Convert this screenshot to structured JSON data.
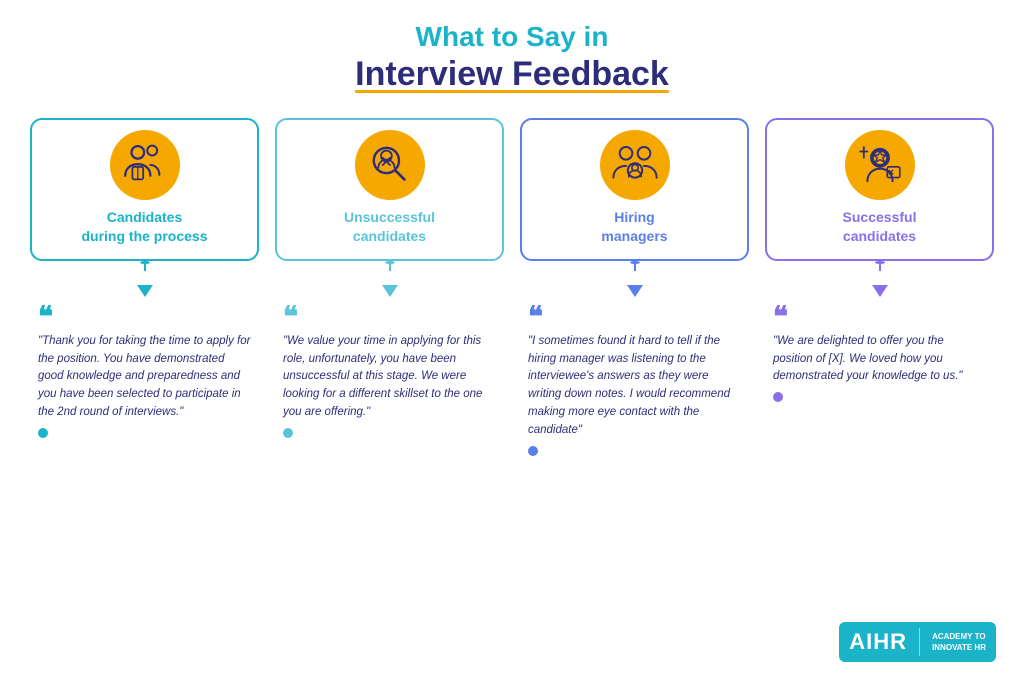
{
  "header": {
    "subtitle": "What to Say in",
    "title": "Interview Feedback"
  },
  "cards": [
    {
      "id": "candidates-process",
      "label": "Candidates\nduring the process",
      "color": "#1ab3c8",
      "quote": "\"Thank you for taking the time to apply for the position. You have demonstrated good knowledge and preparedness and you have been selected to participate in the 2nd round of interviews.\""
    },
    {
      "id": "unsuccessful-candidates",
      "label": "Unsuccessful\ncandidates",
      "color": "#5bc4d8",
      "quote": "\"We value your time in applying for this role, unfortunately, you have been unsuccessful at this stage. We were looking for a different skillset to the one you are offering.\""
    },
    {
      "id": "hiring-managers",
      "label": "Hiring\nmanagers",
      "color": "#5b7fe8",
      "quote": "\"I sometimes found it hard to tell if the hiring manager was listening to the interviewee's answers as they were writing down notes. I would recommend making more eye contact with the candidate\""
    },
    {
      "id": "successful-candidates",
      "label": "Successful\ncandidates",
      "color": "#8a6fe8",
      "quote": "\"We are delighted to offer you the position of [X]. We loved how you demonstrated your knowledge to us.\""
    }
  ],
  "logo": {
    "main": "AIHR",
    "sub_line1": "ACADEMY TO",
    "sub_line2": "INNOVATE HR"
  }
}
